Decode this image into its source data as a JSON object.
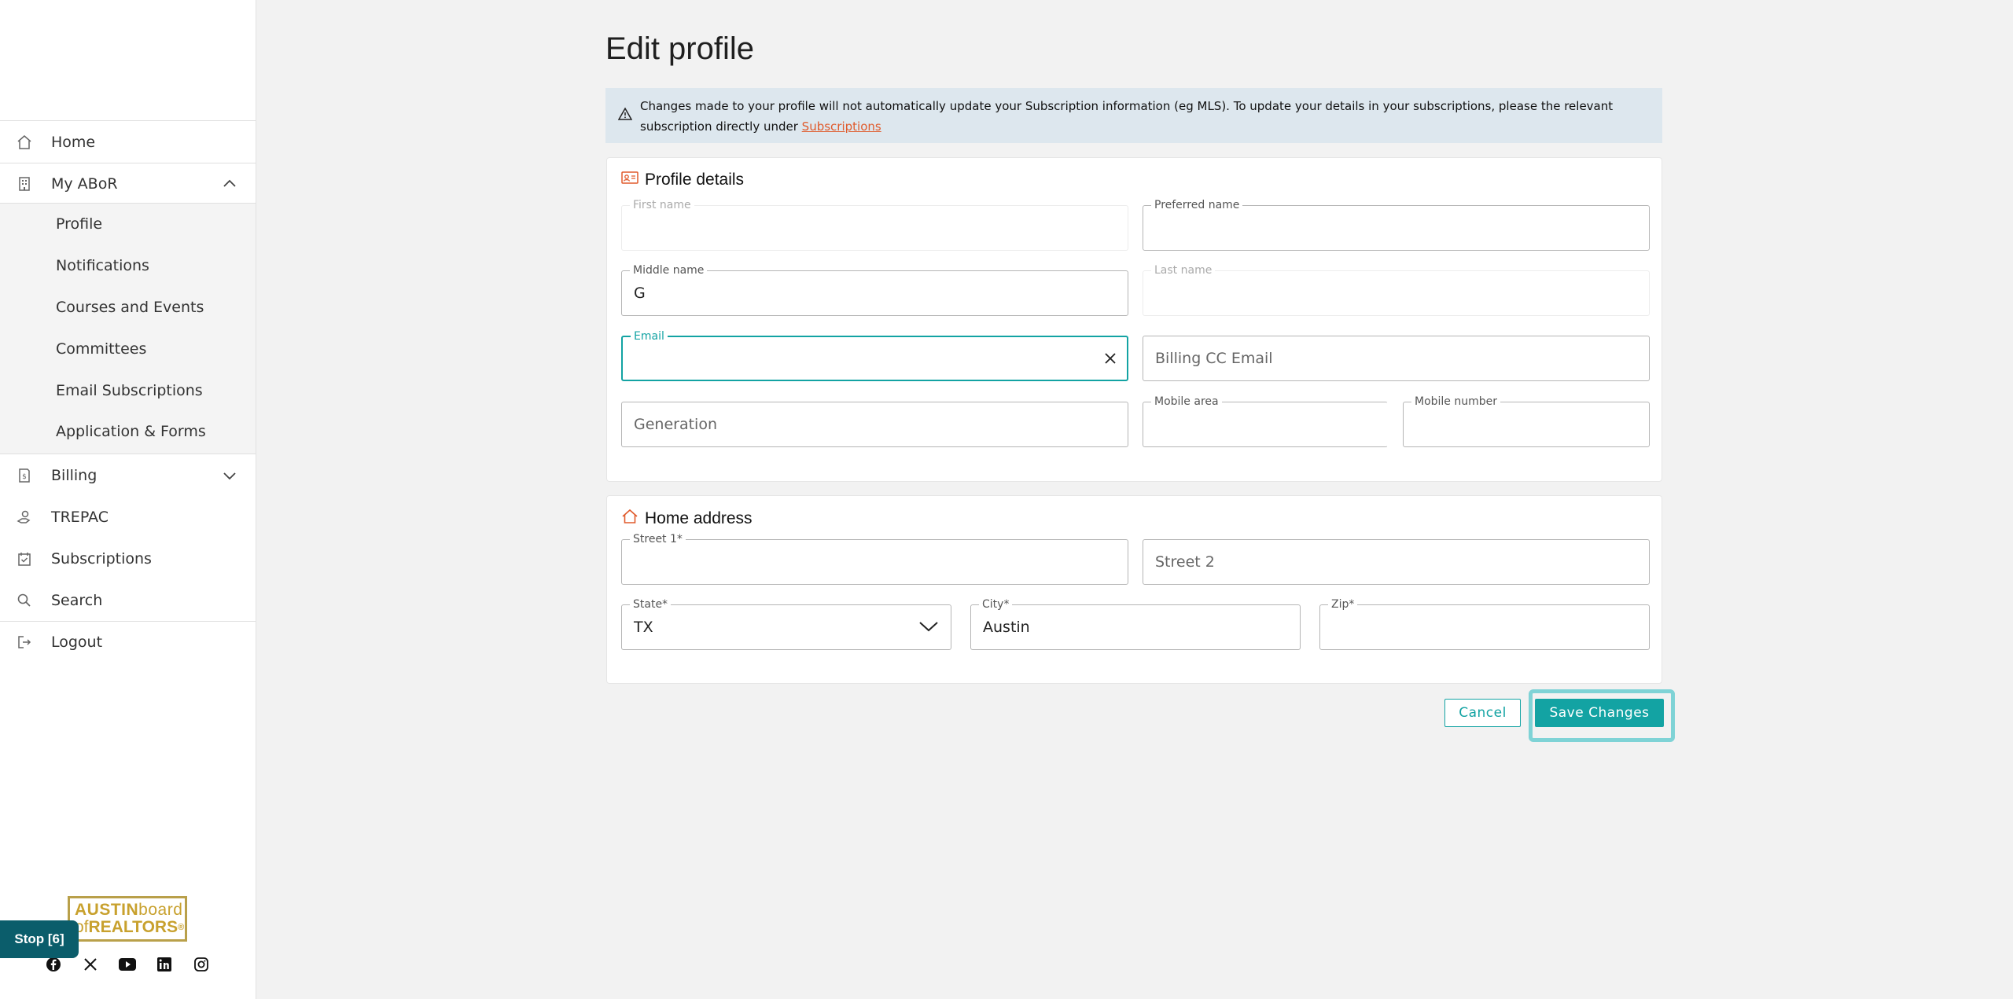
{
  "sidebar": {
    "items": [
      {
        "label": "Home",
        "icon": "home-icon"
      },
      {
        "label": "My ABoR",
        "icon": "building-icon"
      },
      {
        "label": "Billing",
        "icon": "receipt-icon"
      },
      {
        "label": "TREPAC",
        "icon": "hand-coin-icon"
      },
      {
        "label": "Subscriptions",
        "icon": "calendar-check-icon"
      },
      {
        "label": "Search",
        "icon": "search-icon"
      },
      {
        "label": "Logout",
        "icon": "logout-icon"
      }
    ],
    "subitems": [
      {
        "label": "Profile"
      },
      {
        "label": "Notifications"
      },
      {
        "label": "Courses and Events"
      },
      {
        "label": "Committees"
      },
      {
        "label": "Email Subscriptions"
      },
      {
        "label": "Application & Forms"
      }
    ],
    "logo": {
      "line1_bold": "AUSTIN",
      "line1_light": "board",
      "line2_light": "of",
      "line2_bold": "REALTORS",
      "reg": "®"
    },
    "stop_label": "Stop [6]",
    "social": [
      "facebook-icon",
      "x-icon",
      "youtube-icon",
      "linkedin-icon",
      "instagram-icon"
    ]
  },
  "main": {
    "title": "Edit profile",
    "notice": {
      "text": "Changes made to your profile will not automatically update your Subscription information (eg MLS). To update your details in your subscriptions, please the relevant subscription directly under ",
      "link": "Subscriptions"
    },
    "profile": {
      "title": "Profile details",
      "first_name": {
        "label": "First name",
        "value": ""
      },
      "preferred_name": {
        "label": "Preferred name",
        "value": ""
      },
      "middle_name": {
        "label": "Middle name",
        "value": "G"
      },
      "last_name": {
        "label": "Last name",
        "value": ""
      },
      "email": {
        "label": "Email",
        "value": ""
      },
      "billing_cc_email": {
        "placeholder": "Billing CC Email"
      },
      "generation": {
        "placeholder": "Generation"
      },
      "mobile_area": {
        "label": "Mobile area",
        "value": ""
      },
      "mobile_number": {
        "label": "Mobile number",
        "value": ""
      }
    },
    "address": {
      "title": "Home address",
      "street1": {
        "label": "Street 1*",
        "value": ""
      },
      "street2": {
        "placeholder": "Street 2"
      },
      "state": {
        "label": "State*",
        "value": "TX"
      },
      "city": {
        "label": "City*",
        "value": "Austin"
      },
      "zip": {
        "label": "Zip*",
        "value": ""
      }
    },
    "actions": {
      "cancel": "Cancel",
      "save": "Save Changes"
    }
  },
  "colors": {
    "accent": "#13a3a3",
    "notice_bg": "#dde7ee",
    "link": "#e05a2b",
    "stop_bg": "#0b5d6b",
    "logo_gold": "#c8a12e"
  }
}
